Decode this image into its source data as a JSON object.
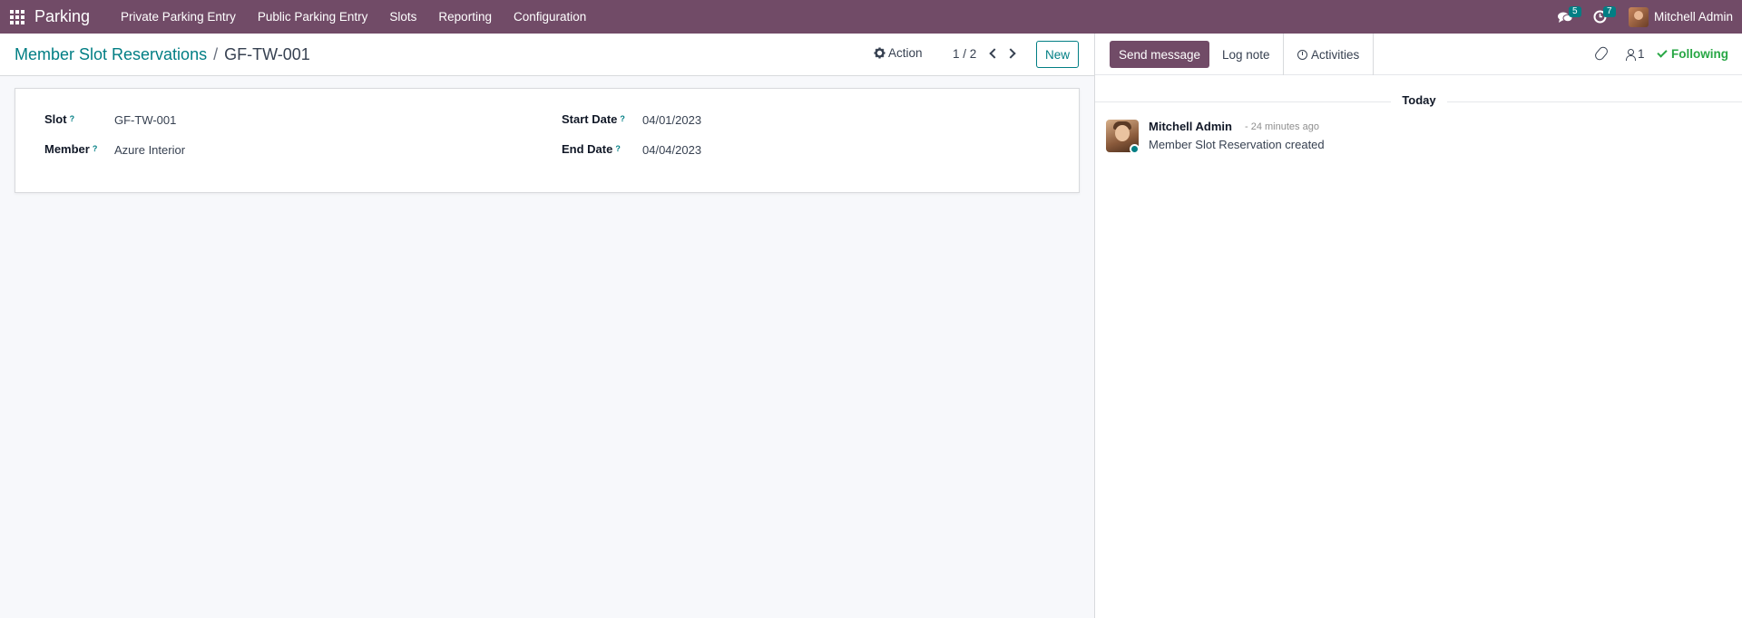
{
  "navbar": {
    "brand": "Parking",
    "menu": [
      "Private Parking Entry",
      "Public Parking Entry",
      "Slots",
      "Reporting",
      "Configuration"
    ],
    "messages_count": "5",
    "activities_count": "7",
    "user_name": "Mitchell Admin",
    "color": "#714b67"
  },
  "control": {
    "breadcrumb_parent": "Member Slot Reservations",
    "breadcrumb_sep": "/",
    "breadcrumb_current": "GF-TW-001",
    "action_label": "Action",
    "pager": "1 / 2",
    "new_label": "New"
  },
  "form": {
    "slot_label": "Slot",
    "slot_value": "GF-TW-001",
    "member_label": "Member",
    "member_value": "Azure Interior",
    "start_label": "Start Date",
    "start_value": "04/01/2023",
    "end_label": "End Date",
    "end_value": "04/04/2023",
    "help_mark": "?"
  },
  "chatter": {
    "send_label": "Send message",
    "log_label": "Log note",
    "activities_label": "Activities",
    "followers_count": "1",
    "following_label": "Following",
    "date_separator": "Today",
    "message": {
      "author": "Mitchell Admin",
      "time": "- 24 minutes ago",
      "body": "Member Slot Reservation created"
    }
  }
}
